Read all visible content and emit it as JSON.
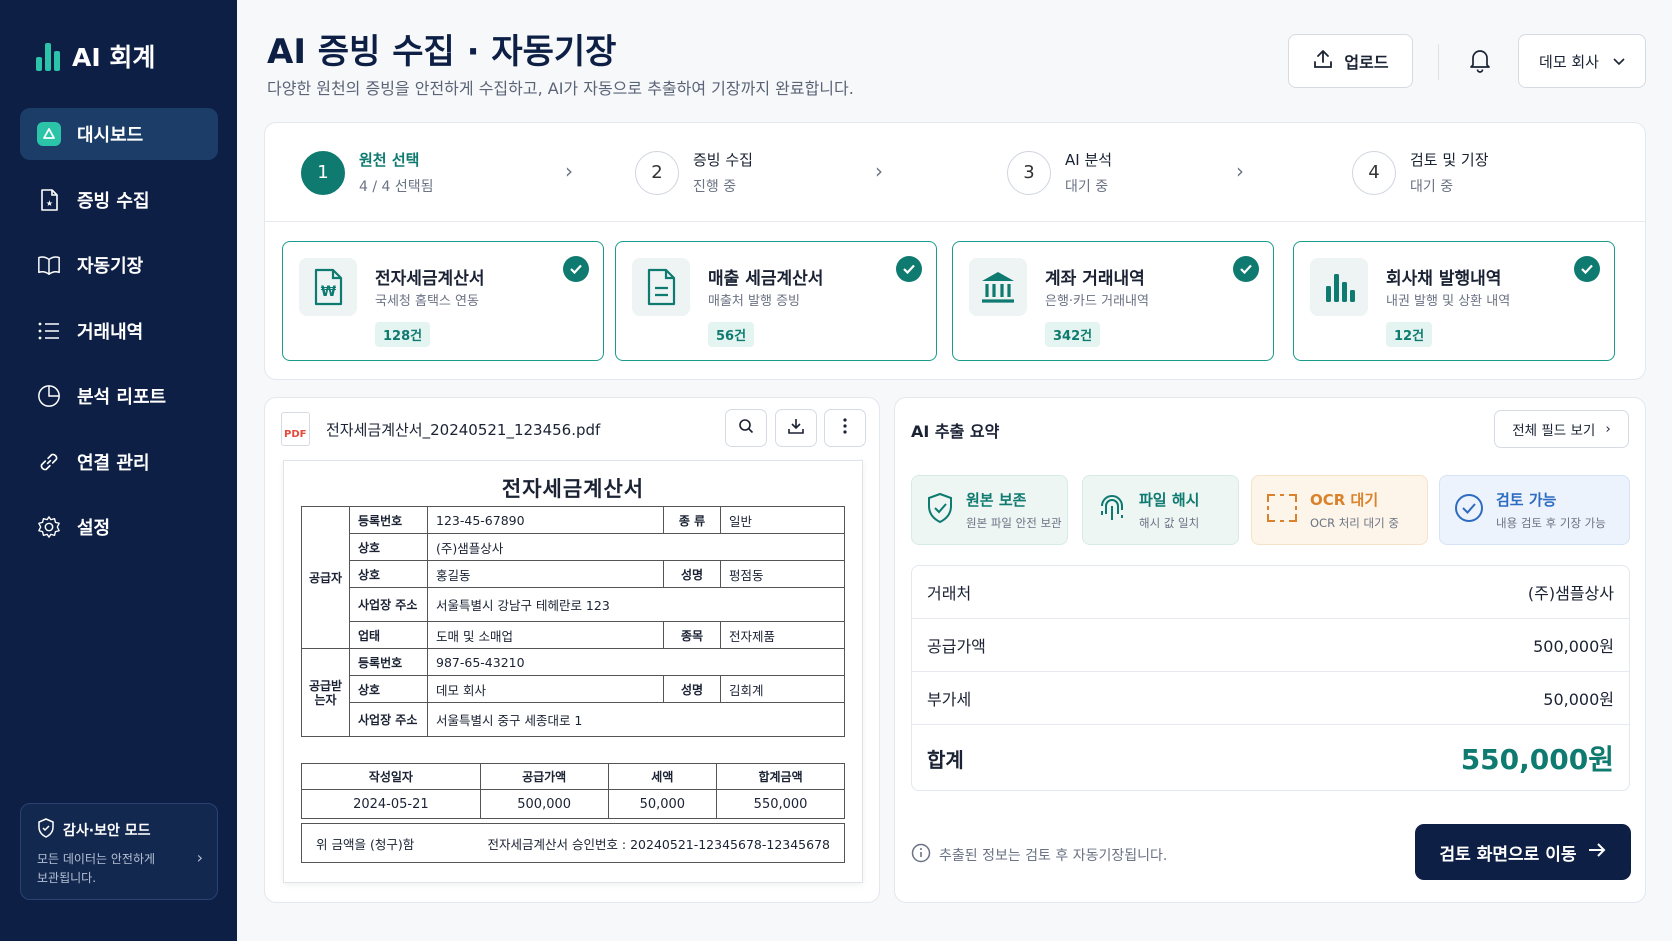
{
  "app": {
    "title": "AI 회계"
  },
  "sidebar": {
    "items": [
      {
        "label": "대시보드",
        "icon": "dashboard-icon",
        "active": true
      },
      {
        "label": "증빙 수집",
        "icon": "receipt-icon"
      },
      {
        "label": "자동기장",
        "icon": "book-icon"
      },
      {
        "label": "거래내역",
        "icon": "list-icon"
      },
      {
        "label": "분석 리포트",
        "icon": "pie-chart-icon"
      },
      {
        "label": "연결 관리",
        "icon": "link-icon"
      },
      {
        "label": "설정",
        "icon": "gear-icon"
      }
    ],
    "audit": {
      "title": "감사·보안 모드",
      "desc": "모든 데이터는 안전하게 보관됩니다."
    }
  },
  "header": {
    "title": "AI 증빙 수집 · 자동기장",
    "subtitle": "다양한 원천의 증빙을 안전하게 수집하고, AI가 자동으로 추출하여 기장까지 완료합니다.",
    "upload_label": "업로드",
    "company": "데모 회사"
  },
  "steps": [
    {
      "num": "1",
      "title": "원천 선택",
      "sub": "4 / 4 선택됨",
      "active": true
    },
    {
      "num": "2",
      "title": "증빙 수집",
      "sub": "진행 중"
    },
    {
      "num": "3",
      "title": "AI 분석",
      "sub": "대기 중"
    },
    {
      "num": "4",
      "title": "검토 및 기장",
      "sub": "대기 중"
    }
  ],
  "sources": [
    {
      "title": "전자세금계산서",
      "desc": "국세청 홈택스 연동",
      "count": "128건",
      "icon": "tax-invoice-icon"
    },
    {
      "title": "매출 세금계산서",
      "desc": "매출처 발행 증빙",
      "count": "56건",
      "icon": "document-icon"
    },
    {
      "title": "계좌 거래내역",
      "desc": "은행·카드 거래내역",
      "count": "342건",
      "icon": "bank-icon"
    },
    {
      "title": "회사채 발행내역",
      "desc": "내권 발행 및 상환 내역",
      "count": "12건",
      "icon": "bar-chart-icon"
    }
  ],
  "document": {
    "filename": "전자세금계산서_20240521_123456.pdf",
    "pdf_badge": "PDF",
    "invoice": {
      "title": "전자세금계산서",
      "supplier_label": "공급자",
      "receiver_label": "공급받는자",
      "supplier": {
        "reg_label": "등록번호",
        "reg": "123-45-67890",
        "type_label": "종 류",
        "type": "일반",
        "name_label": "상호",
        "name": "(주)샘플상사",
        "name2_label": "상호",
        "name2": "홍길동",
        "rep_label": "성명",
        "rep": "펑점동",
        "addr_label": "사업장 주소",
        "addr": "서울특별시 강남구 테헤란로 123",
        "biz_label": "업태",
        "biz": "도매 및 소매업",
        "item_label": "종목",
        "item": "전자제품"
      },
      "receiver": {
        "reg_label": "등록번호",
        "reg": "987-65-43210",
        "name_label": "상호",
        "name": "데모 회사",
        "rep_label": "성명",
        "rep": "김회계",
        "addr_label": "사업장 주소",
        "addr": "서울특별시 중구 세종대로 1"
      },
      "totals": {
        "headers": [
          "작성일자",
          "공급가액",
          "세액",
          "합계금액"
        ],
        "values": [
          "2024-05-21",
          "500,000",
          "50,000",
          "550,000"
        ]
      },
      "footer_left": "위 금액을 (청구)함",
      "footer_right": "전자세금계산서 승인번호 : 20240521-12345678-12345678"
    }
  },
  "ai_summary": {
    "title": "AI 추출 요약",
    "all_fields_label": "전체 필드 보기",
    "statuses": [
      {
        "title": "원본 보존",
        "desc": "원본 파일 안전 보관",
        "icon": "shield-check-icon",
        "color": "#0f7a6f"
      },
      {
        "title": "파일 해시",
        "desc": "해시 값 일치",
        "icon": "fingerprint-icon",
        "color": "#0f7a6f"
      },
      {
        "title": "OCR 대기",
        "desc": "OCR 처리 대기 중",
        "icon": "scan-icon",
        "color": "#d9822b"
      },
      {
        "title": "검토 가능",
        "desc": "내용 검토 후 기장 가능",
        "icon": "check-circle-icon",
        "color": "#2d6cc0"
      }
    ],
    "rows": [
      {
        "label": "거래처",
        "value": "(주)샘플상사"
      },
      {
        "label": "공급가액",
        "value": "500,000원"
      },
      {
        "label": "부가세",
        "value": "50,000원"
      }
    ],
    "total_label": "합계",
    "total_value": "550,000원",
    "note": "추출된 정보는 검토 후 자동기장됩니다.",
    "review_label": "검토 화면으로 이동"
  }
}
